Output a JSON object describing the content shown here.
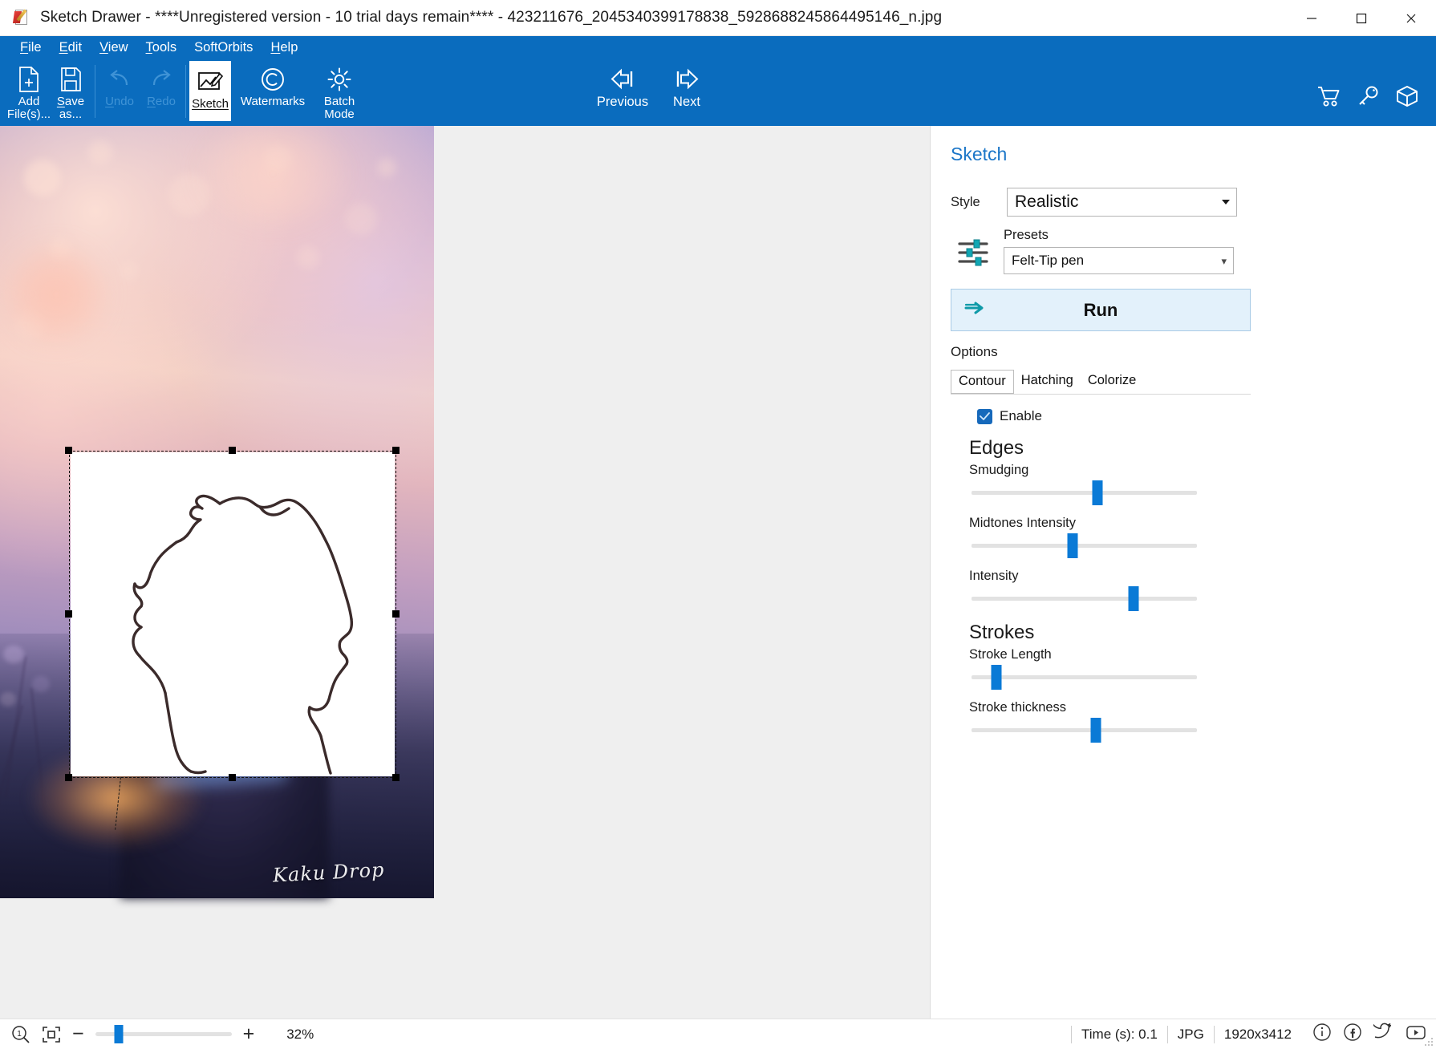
{
  "window": {
    "title": "Sketch Drawer - ****Unregistered version - 10 trial days remain**** - 423211676_2045340399178838_5928688245864495146_n.jpg",
    "app_icon": "sketch-drawer-app-icon",
    "minimize": "minimize-icon",
    "maximize": "maximize-icon",
    "close": "close-icon"
  },
  "menubar": {
    "items": [
      {
        "label": "File",
        "accel": "F"
      },
      {
        "label": "Edit",
        "accel": "E"
      },
      {
        "label": "View",
        "accel": "V"
      },
      {
        "label": "Tools",
        "accel": "T"
      },
      {
        "label": "SoftOrbits",
        "accel": ""
      },
      {
        "label": "Help",
        "accel": "H"
      }
    ]
  },
  "ribbon": {
    "add_files": {
      "line1": "Add",
      "line2": "File(s)..."
    },
    "save_as": {
      "line1": "Save",
      "line2": "as..."
    },
    "undo": "Undo",
    "redo": "Redo",
    "sketch": "Sketch",
    "watermarks": "Watermarks",
    "batch_mode": {
      "line1": "Batch",
      "line2": "Mode"
    },
    "previous": "Previous",
    "next": "Next",
    "right_icons": [
      "cart-icon",
      "key-icon",
      "box-icon"
    ]
  },
  "panel": {
    "title": "Sketch",
    "style_label": "Style",
    "style_value": "Realistic",
    "presets_label": "Presets",
    "presets_value": "Felt-Tip pen",
    "run_label": "Run",
    "options_label": "Options",
    "tabs": [
      {
        "label": "Contour",
        "selected": true
      },
      {
        "label": "Hatching",
        "selected": false
      },
      {
        "label": "Colorize",
        "selected": false
      }
    ],
    "enable_label": "Enable",
    "enable_checked": true,
    "sections": [
      {
        "heading": "Edges",
        "sliders": [
          {
            "label": "Smudging",
            "percent": 56
          },
          {
            "label": "Midtones Intensity",
            "percent": 45
          },
          {
            "label": "Intensity",
            "percent": 72
          }
        ]
      },
      {
        "heading": "Strokes",
        "sliders": [
          {
            "label": "Stroke Length",
            "percent": 11
          },
          {
            "label": "Stroke thickness",
            "percent": 55
          }
        ]
      }
    ]
  },
  "canvas": {
    "watermark": "Kaku Drop",
    "selection": "sketch-selection-marquee"
  },
  "statusbar": {
    "zoom_1to1": "actual-size-icon",
    "fit_screen": "fit-to-screen-icon",
    "minus": "−",
    "plus": "+",
    "zoom_percent": "32%",
    "zoom_slider_percent": 17,
    "time": "Time (s): 0.1",
    "format": "JPG",
    "dimensions": "1920x3412",
    "social": [
      "info-icon",
      "facebook-icon",
      "twitter-icon",
      "youtube-icon"
    ]
  },
  "colors": {
    "ribbon_blue": "#0a6cbe",
    "accent_blue": "#1b76c8",
    "slider_blue": "#0a7ad6",
    "run_bg": "#e3f1fb",
    "teal": "#0f9aa8"
  }
}
